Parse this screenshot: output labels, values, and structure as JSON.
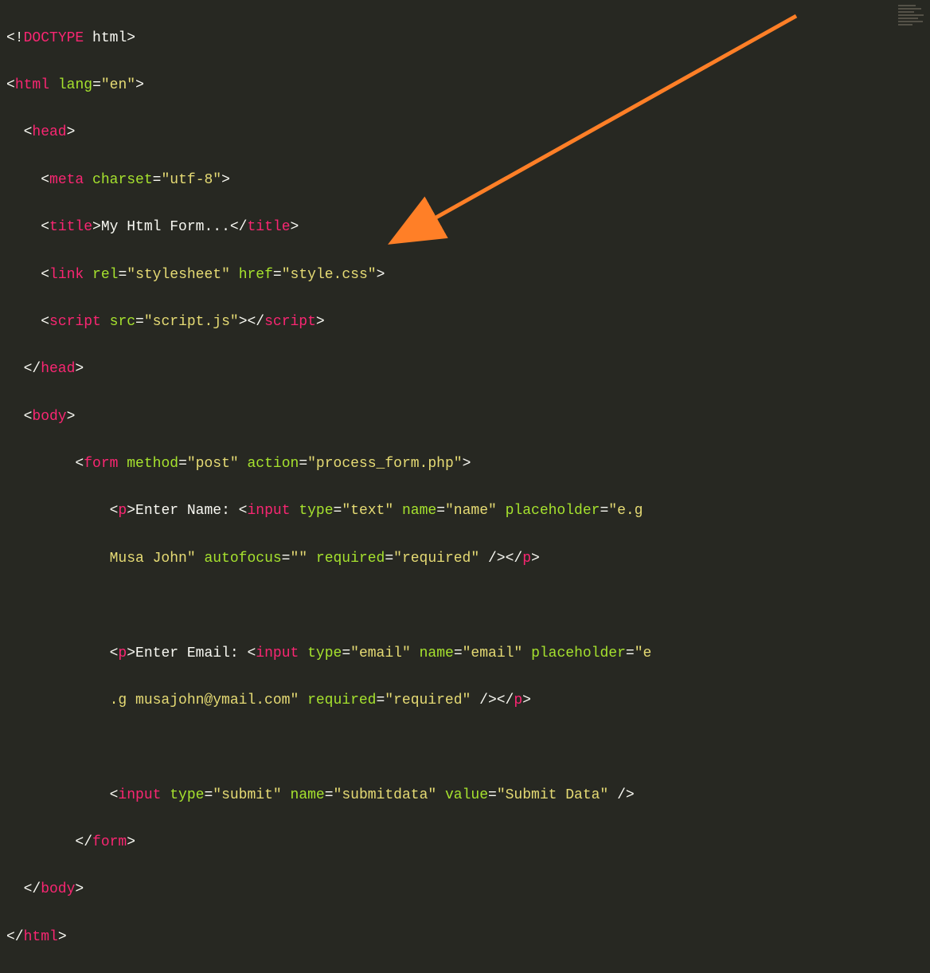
{
  "code": {
    "l1_doctype": "DOCTYPE",
    "l1_html": " html",
    "l2_tag": "html",
    "l2_attr": "lang",
    "l2_val": "\"en\"",
    "l3_tag": "head",
    "l4_tag": "meta",
    "l4_attr": "charset",
    "l4_val": "\"utf-8\"",
    "l5_tag_open": "title",
    "l5_text": "My Html Form...",
    "l5_tag_close": "title",
    "l6_tag": "link",
    "l6_attr1": "rel",
    "l6_val1": "\"stylesheet\"",
    "l6_attr2": "href",
    "l6_val2": "\"style.css\"",
    "l7_tag_open": "script",
    "l7_attr": "src",
    "l7_val": "\"script.js\"",
    "l7_tag_close": "script",
    "l8_tag": "head",
    "l9_tag": "body",
    "l10_tag": "form",
    "l10_attr1": "method",
    "l10_val1": "\"post\"",
    "l10_attr2": "action",
    "l10_val2": "\"process_form.php\"",
    "l11_tag_p": "p",
    "l11_text": "Enter Name: ",
    "l11_tag_input": "input",
    "l11_attr1": "type",
    "l11_val1": "\"text\"",
    "l11_attr2": "name",
    "l11_val2": "\"name\"",
    "l11_attr3": "placeholder",
    "l11_val3": "\"e.g ",
    "l12_wrap": "Musa John\"",
    "l12_attr4": "autofocus",
    "l12_val4": "\"\"",
    "l12_attr5": "required",
    "l12_val5": "\"required\"",
    "l14_tag_p": "p",
    "l14_text": "Enter Email: ",
    "l14_tag_input": "input",
    "l14_attr1": "type",
    "l14_val1": "\"email\"",
    "l14_attr2": "name",
    "l14_val2": "\"email\"",
    "l14_attr3": "placeholder",
    "l14_val3": "\"e",
    "l15_wrap": ".g musajohn@ymail.com\"",
    "l15_attr4": "required",
    "l15_val4": "\"required\"",
    "l17_tag_input": "input",
    "l17_attr1": "type",
    "l17_val1": "\"submit\"",
    "l17_attr2": "name",
    "l17_val2": "\"submitdata\"",
    "l17_attr3": "value",
    "l17_val3": "\"Submit Data\"",
    "l18_tag": "form",
    "l19_tag": "body",
    "l20_tag": "html"
  },
  "annotation": {
    "arrow_color": "#ff7f27"
  }
}
